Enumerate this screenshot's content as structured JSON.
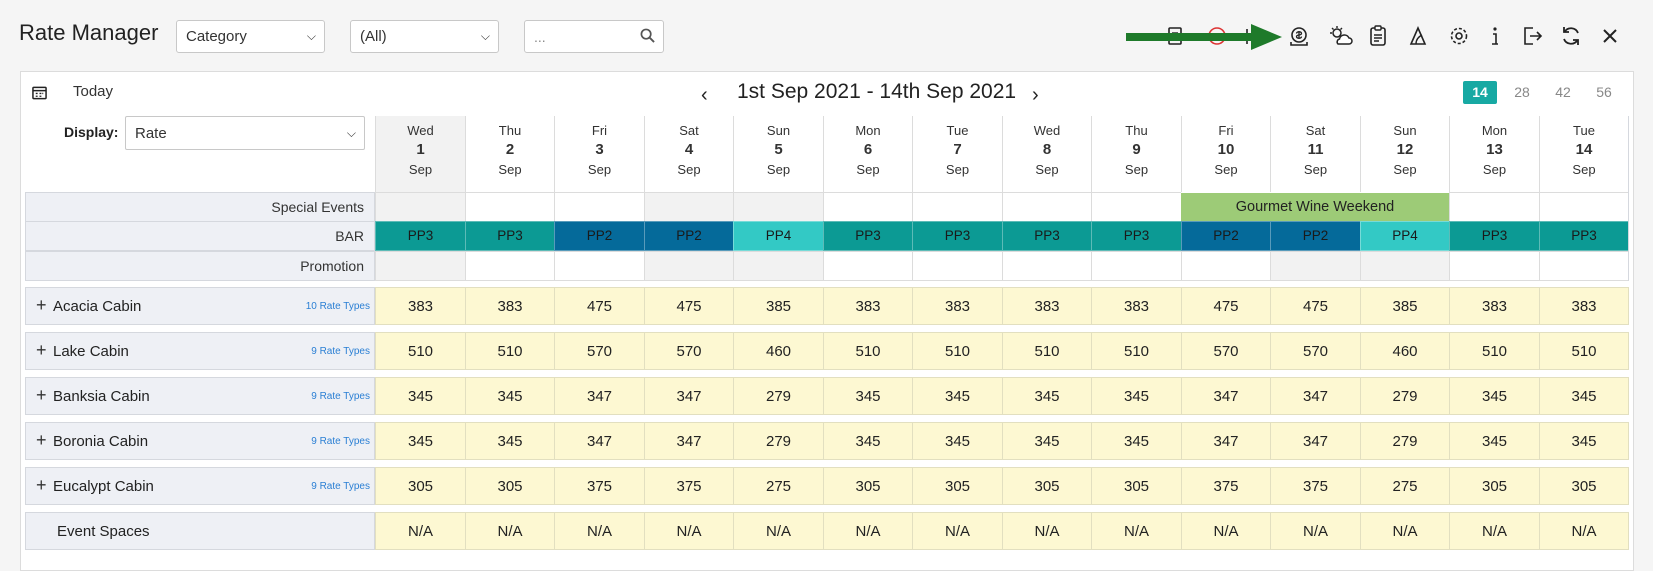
{
  "header": {
    "title": "Rate Manager",
    "category_select": "Category",
    "filter_select": "(All)",
    "search_placeholder": "..."
  },
  "toolbar_icons": [
    "print-icon",
    "no-entry-icon",
    "flag-icon",
    "rate-upload-icon",
    "weather-icon",
    "clipboard-icon",
    "alert-icon",
    "gear-icon",
    "info-icon",
    "logout-icon",
    "refresh-icon",
    "close-icon"
  ],
  "nav": {
    "today_label": "Today",
    "date_range": "1st Sep 2021 - 14th Sep 2021",
    "pager": [
      "14",
      "28",
      "42",
      "56"
    ],
    "active_pager": "14"
  },
  "display": {
    "label": "Display:",
    "value": "Rate"
  },
  "days": [
    {
      "dow": "Wed",
      "day": "1",
      "mon": "Sep",
      "shade": true
    },
    {
      "dow": "Thu",
      "day": "2",
      "mon": "Sep",
      "shade": false
    },
    {
      "dow": "Fri",
      "day": "3",
      "mon": "Sep",
      "shade": false
    },
    {
      "dow": "Sat",
      "day": "4",
      "mon": "Sep",
      "shade": false
    },
    {
      "dow": "Sun",
      "day": "5",
      "mon": "Sep",
      "shade": false
    },
    {
      "dow": "Mon",
      "day": "6",
      "mon": "Sep",
      "shade": false
    },
    {
      "dow": "Tue",
      "day": "7",
      "mon": "Sep",
      "shade": false
    },
    {
      "dow": "Wed",
      "day": "8",
      "mon": "Sep",
      "shade": false
    },
    {
      "dow": "Thu",
      "day": "9",
      "mon": "Sep",
      "shade": false
    },
    {
      "dow": "Fri",
      "day": "10",
      "mon": "Sep",
      "shade": false
    },
    {
      "dow": "Sat",
      "day": "11",
      "mon": "Sep",
      "shade": false
    },
    {
      "dow": "Sun",
      "day": "12",
      "mon": "Sep",
      "shade": false
    },
    {
      "dow": "Mon",
      "day": "13",
      "mon": "Sep",
      "shade": false
    },
    {
      "dow": "Tue",
      "day": "14",
      "mon": "Sep",
      "shade": false
    }
  ],
  "rows": {
    "special_events_label": "Special Events",
    "bar_label": "BAR",
    "promotion_label": "Promotion",
    "special_event": {
      "name": "Gourmet Wine Weekend",
      "start_day_index": 9,
      "end_day_index": 11,
      "color": "#9dcb77"
    },
    "bar_values": [
      "PP3",
      "PP3",
      "PP2",
      "PP2",
      "PP4",
      "PP3",
      "PP3",
      "PP3",
      "PP3",
      "PP2",
      "PP2",
      "PP4",
      "PP3",
      "PP3"
    ],
    "bar_colors": {
      "PP2": "#056a9a",
      "PP3": "#0c9a94",
      "PP4": "#33c9c5"
    }
  },
  "rooms": [
    {
      "name": "Acacia Cabin",
      "rate_types": "10 Rate Types",
      "rates": [
        "383",
        "383",
        "475",
        "475",
        "385",
        "383",
        "383",
        "383",
        "383",
        "475",
        "475",
        "385",
        "383",
        "383"
      ]
    },
    {
      "name": "Lake Cabin",
      "rate_types": "9 Rate Types",
      "rates": [
        "510",
        "510",
        "570",
        "570",
        "460",
        "510",
        "510",
        "510",
        "510",
        "570",
        "570",
        "460",
        "510",
        "510"
      ]
    },
    {
      "name": "Banksia Cabin",
      "rate_types": "9 Rate Types",
      "rates": [
        "345",
        "345",
        "347",
        "347",
        "279",
        "345",
        "345",
        "345",
        "345",
        "347",
        "347",
        "279",
        "345",
        "345"
      ]
    },
    {
      "name": "Boronia Cabin",
      "rate_types": "9 Rate Types",
      "rates": [
        "345",
        "345",
        "347",
        "347",
        "279",
        "345",
        "345",
        "345",
        "345",
        "347",
        "347",
        "279",
        "345",
        "345"
      ]
    },
    {
      "name": "Eucalypt Cabin",
      "rate_types": "9 Rate Types",
      "rates": [
        "305",
        "305",
        "375",
        "375",
        "275",
        "305",
        "305",
        "305",
        "305",
        "375",
        "375",
        "275",
        "305",
        "305"
      ]
    },
    {
      "name": "Event Spaces",
      "rate_types": "",
      "rates": [
        "N/A",
        "N/A",
        "N/A",
        "N/A",
        "N/A",
        "N/A",
        "N/A",
        "N/A",
        "N/A",
        "N/A",
        "N/A",
        "N/A",
        "N/A",
        "N/A"
      ]
    }
  ]
}
